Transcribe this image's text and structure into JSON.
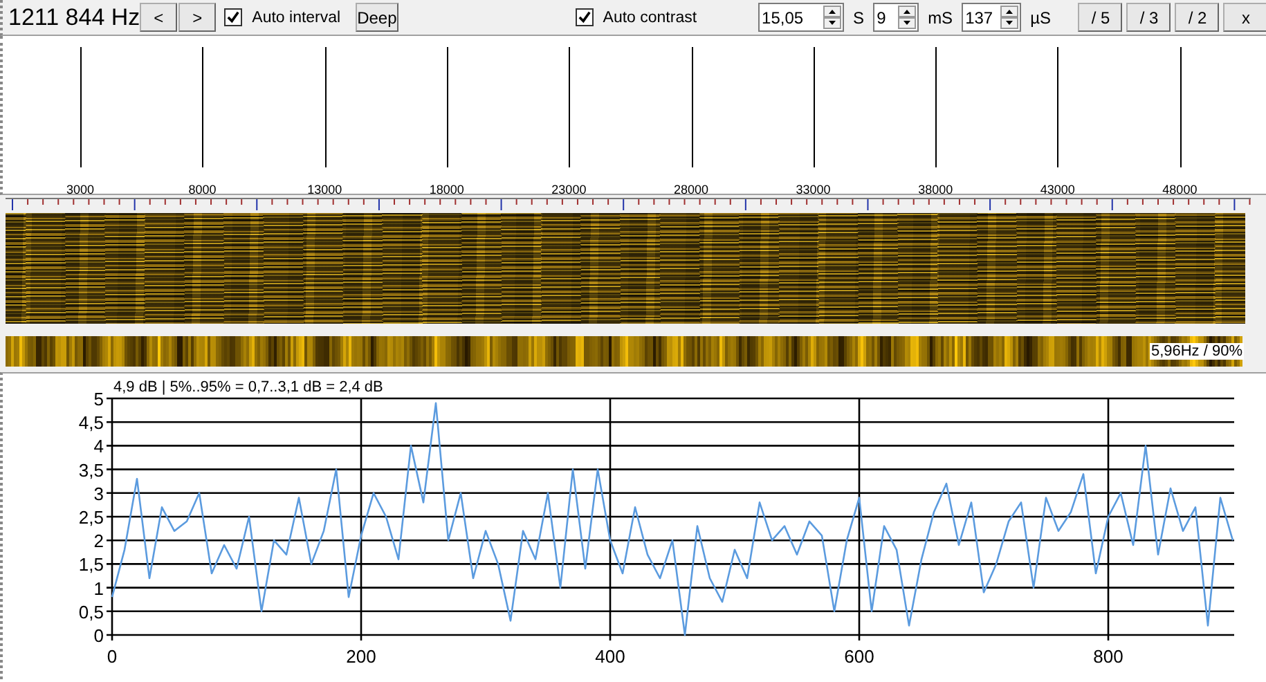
{
  "toolbar": {
    "frequency": "1211 844 Hz",
    "prev_button": "<",
    "next_button": ">",
    "auto_interval": {
      "label": "Auto interval",
      "checked": true
    },
    "deep_button": "Deep",
    "auto_contrast": {
      "label": "Auto contrast",
      "checked": true
    },
    "spinners": [
      {
        "value": "15,05",
        "unit": "S"
      },
      {
        "value": "9",
        "unit": "mS"
      },
      {
        "value": "137",
        "unit": "µS"
      }
    ],
    "scale_buttons": [
      "/ 5",
      "/ 3",
      "/ 2",
      "x"
    ]
  },
  "markers": {
    "labels": [
      "3000",
      "8000",
      "13000",
      "18000",
      "23000",
      "28000",
      "33000",
      "38000",
      "43000",
      "48000"
    ]
  },
  "strip": {
    "reading": "5,96Hz / 90%"
  },
  "chart": {
    "chart_data": {
      "type": "line",
      "title": "4,9 dB | 5%..95% = 0,7..3,1 dB = 2,4 dB",
      "xlim": [
        0,
        900
      ],
      "ylim": [
        0,
        5
      ],
      "xticks": [
        0,
        200,
        400,
        600,
        800
      ],
      "yticks": [
        {
          "value": 0,
          "label": "0"
        },
        {
          "value": 0.5,
          "label": "0,5"
        },
        {
          "value": 1,
          "label": "1"
        },
        {
          "value": 1.5,
          "label": "1,5"
        },
        {
          "value": 2,
          "label": "2"
        },
        {
          "value": 2.5,
          "label": "2,5"
        },
        {
          "value": 3,
          "label": "3"
        },
        {
          "value": 3.5,
          "label": "3,5"
        },
        {
          "value": 4,
          "label": "4"
        },
        {
          "value": 4.5,
          "label": "4,5"
        },
        {
          "value": 5,
          "label": "5"
        }
      ],
      "x": [
        0,
        10,
        20,
        30,
        40,
        50,
        60,
        70,
        80,
        90,
        100,
        110,
        120,
        130,
        140,
        150,
        160,
        170,
        180,
        190,
        200,
        210,
        220,
        230,
        240,
        250,
        260,
        270,
        280,
        290,
        300,
        310,
        320,
        330,
        340,
        350,
        360,
        370,
        380,
        390,
        400,
        410,
        420,
        430,
        440,
        450,
        460,
        470,
        480,
        490,
        500,
        510,
        520,
        530,
        540,
        550,
        560,
        570,
        580,
        590,
        600,
        610,
        620,
        630,
        640,
        650,
        660,
        670,
        680,
        690,
        700,
        710,
        720,
        730,
        740,
        750,
        760,
        770,
        780,
        790,
        800,
        810,
        820,
        830,
        840,
        850,
        860,
        870,
        880,
        890,
        900
      ],
      "grid": true,
      "series": [
        {
          "color": "#5b9bdf",
          "values": [
            0.8,
            1.8,
            3.3,
            1.2,
            2.7,
            2.2,
            2.4,
            3.0,
            1.3,
            1.9,
            1.4,
            2.5,
            0.5,
            2.0,
            1.7,
            2.9,
            1.5,
            2.2,
            3.5,
            0.8,
            2.1,
            3.0,
            2.5,
            1.6,
            4.0,
            2.8,
            4.9,
            2.0,
            3.0,
            1.2,
            2.2,
            1.5,
            0.3,
            2.2,
            1.6,
            3.0,
            1.0,
            3.5,
            1.4,
            3.5,
            2.0,
            1.3,
            2.7,
            1.7,
            1.2,
            2.0,
            0.0,
            2.3,
            1.2,
            0.7,
            1.8,
            1.2,
            2.8,
            2.0,
            2.3,
            1.7,
            2.4,
            2.1,
            0.5,
            2.0,
            2.9,
            0.5,
            2.3,
            1.8,
            0.2,
            1.6,
            2.6,
            3.2,
            1.9,
            2.8,
            0.9,
            1.5,
            2.4,
            2.8,
            1.0,
            2.9,
            2.2,
            2.6,
            3.4,
            1.3,
            2.5,
            3.0,
            1.9,
            4.0,
            1.7,
            3.1,
            2.2,
            2.7,
            0.2,
            2.9,
            2.0
          ]
        }
      ]
    }
  }
}
